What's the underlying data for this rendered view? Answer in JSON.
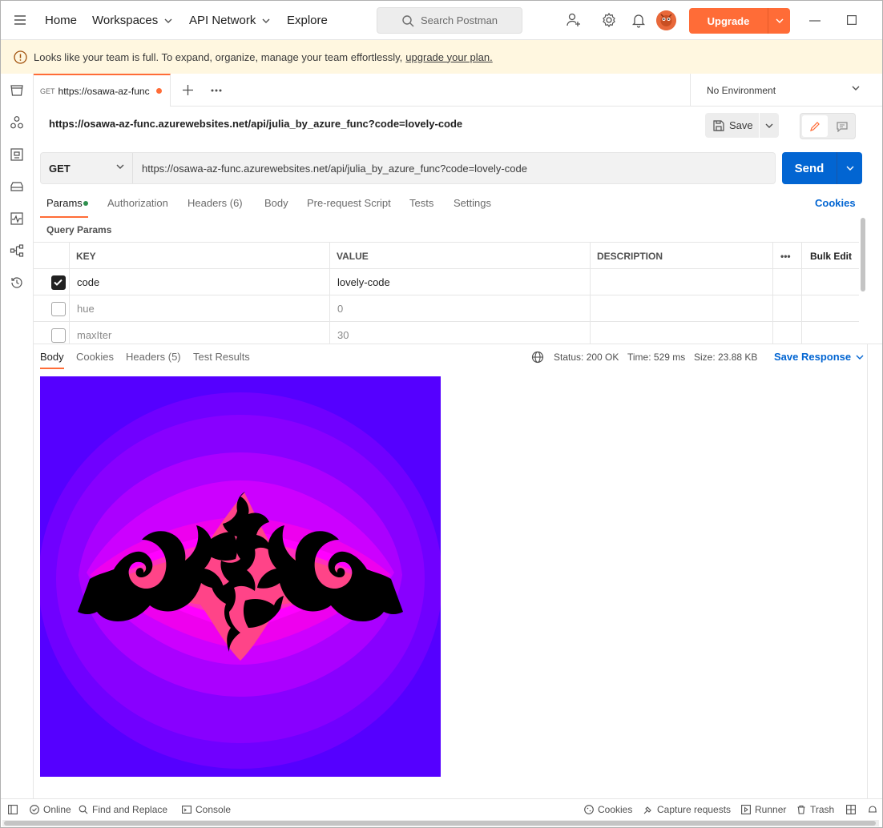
{
  "topbar": {
    "nav": [
      "Home",
      "Workspaces",
      "API Network",
      "Explore"
    ],
    "search_placeholder": "Search Postman",
    "upgrade_label": "Upgrade"
  },
  "banner": {
    "text": "Looks like your team is full. To expand, organize, manage your team effortlessly,",
    "link": "upgrade your plan."
  },
  "tab": {
    "method": "GET",
    "title": "https://osawa-az-func",
    "unsaved": true
  },
  "environment": "No Environment",
  "request": {
    "name": "https://osawa-az-func.azurewebsites.net/api/julia_by_azure_func?code=lovely-code",
    "save_label": "Save",
    "method": "GET",
    "url": "https://osawa-az-func.azurewebsites.net/api/julia_by_azure_func?code=lovely-code",
    "send_label": "Send"
  },
  "request_tabs": [
    "Params",
    "Authorization",
    "Headers (6)",
    "Body",
    "Pre-request Script",
    "Tests",
    "Settings"
  ],
  "cookies_label": "Cookies",
  "query_params": {
    "label": "Query Params",
    "headers": {
      "key": "KEY",
      "value": "VALUE",
      "description": "DESCRIPTION",
      "more": "•••",
      "bulk_edit": "Bulk Edit"
    },
    "rows": [
      {
        "key": "code",
        "value": "lovely-code",
        "description": "",
        "checked": true
      },
      {
        "key": "hue",
        "value": "0",
        "description": "",
        "checked": false
      },
      {
        "key": "maxIter",
        "value": "30",
        "description": "",
        "checked": false
      }
    ]
  },
  "response": {
    "tabs": [
      "Body",
      "Cookies",
      "Headers (5)",
      "Test Results"
    ],
    "status": "Status: 200 OK",
    "time": "Time: 529 ms",
    "size": "Size: 23.88 KB",
    "save_response": "Save Response",
    "image_description": "Julia set fractal rendering",
    "colors": {
      "outer": "#5500ff",
      "mid": "#aa00ff",
      "inner": "#ff00ff",
      "core": "#000000"
    }
  },
  "statusbar": {
    "left": [
      "Online",
      "Find and Replace",
      "Console"
    ],
    "right": [
      "Cookies",
      "Capture requests",
      "Runner",
      "Trash"
    ]
  },
  "colors": {
    "accent": "#ff6c37",
    "primary": "#0265d2"
  }
}
